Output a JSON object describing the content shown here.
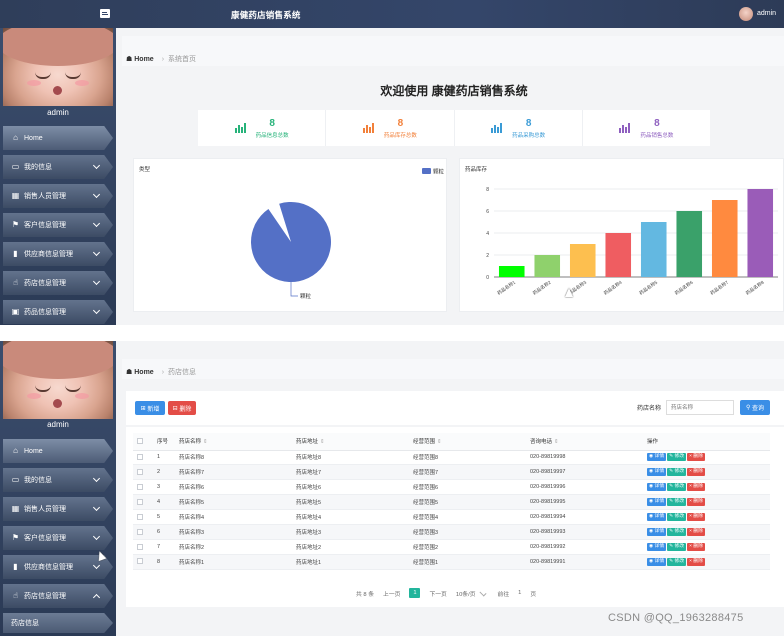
{
  "app": {
    "title": "康健药店销售系统",
    "user": "admin"
  },
  "sidebar": {
    "username": "admin",
    "items": [
      {
        "label": "Home",
        "icon": "home-icon"
      },
      {
        "label": "我的信息",
        "icon": "card-icon"
      },
      {
        "label": "销售人员管理",
        "icon": "grid-icon"
      },
      {
        "label": "客户信息管理",
        "icon": "flag-icon"
      },
      {
        "label": "供应商信息管理",
        "icon": "chart-icon"
      },
      {
        "label": "药店信息管理",
        "icon": "thumb-icon"
      },
      {
        "label": "药品信息管理",
        "icon": "cart-icon"
      }
    ],
    "subitem": "药店信息"
  },
  "screen1": {
    "breadcrumb": {
      "home": "Home",
      "current": "系统首页"
    },
    "welcome": "欢迎使用 康健药店销售系统",
    "stats": [
      {
        "value": "8",
        "label": "药品信息总数",
        "color": "#27b37a"
      },
      {
        "value": "8",
        "label": "药品库存总数",
        "color": "#f2803a"
      },
      {
        "value": "8",
        "label": "药品采购总数",
        "color": "#3a9bd6"
      },
      {
        "value": "8",
        "label": "药品销售总数",
        "color": "#8e5fbf"
      }
    ]
  },
  "chart_data": [
    {
      "type": "pie",
      "title": "类型",
      "legend": [
        "颗粒"
      ],
      "legend_position": "top-right",
      "slices": [
        {
          "name": "颗粒",
          "value": 1,
          "color": "#5470c6"
        }
      ],
      "slice_label": "颗粒"
    },
    {
      "type": "bar",
      "title": "药品库存",
      "categories": [
        "药品名称1",
        "药品名称2",
        "药品名称3",
        "药品名称4",
        "药品名称5",
        "药品名称6",
        "药品名称7",
        "药品名称8"
      ],
      "values": [
        1,
        2,
        3,
        4,
        5,
        6,
        7,
        8
      ],
      "ylim": [
        0,
        8
      ],
      "yticks": [
        "0",
        "2",
        "4",
        "6",
        "8"
      ],
      "colors": [
        "#00ff00",
        "#8fd16c",
        "#fdbf4f",
        "#ef5d61",
        "#63b8e1",
        "#3aa16a",
        "#ff8a3f",
        "#9a5cb8"
      ],
      "grid": true
    }
  ],
  "screen2": {
    "breadcrumb": {
      "home": "Home",
      "current": "药店信息"
    },
    "buttons": {
      "add": "新增",
      "delete": "删除",
      "search": "查询"
    },
    "search": {
      "label": "药店名称",
      "placeholder": "药店名称"
    },
    "columns": [
      "序号",
      "药店名称",
      "药店地址",
      "经营范围",
      "咨询电话",
      "操作"
    ],
    "rows": [
      [
        "1",
        "药店名称8",
        "药店地址8",
        "经营范围8",
        "020-89819998"
      ],
      [
        "2",
        "药店名称7",
        "药店地址7",
        "经营范围7",
        "020-89819997"
      ],
      [
        "3",
        "药店名称6",
        "药店地址6",
        "经营范围6",
        "020-89819996"
      ],
      [
        "4",
        "药店名称5",
        "药店地址5",
        "经营范围5",
        "020-89819995"
      ],
      [
        "5",
        "药店名称4",
        "药店地址4",
        "经营范围4",
        "020-89819994"
      ],
      [
        "6",
        "药店名称3",
        "药店地址3",
        "经营范围3",
        "020-89819993"
      ],
      [
        "7",
        "药店名称2",
        "药店地址2",
        "经营范围2",
        "020-89819992"
      ],
      [
        "8",
        "药店名称1",
        "药店地址1",
        "经营范围1",
        "020-89819991"
      ]
    ],
    "row_actions": {
      "detail": "详情",
      "edit": "修改",
      "remove": "删除"
    },
    "pager": {
      "total": "共 8 条",
      "prev": "上一页",
      "current": "1",
      "next": "下一页",
      "pagesize": "10条/页",
      "goto": "前往",
      "goto_value": "1",
      "page": "页"
    }
  },
  "watermark": "CSDN @QQ_1963288475"
}
